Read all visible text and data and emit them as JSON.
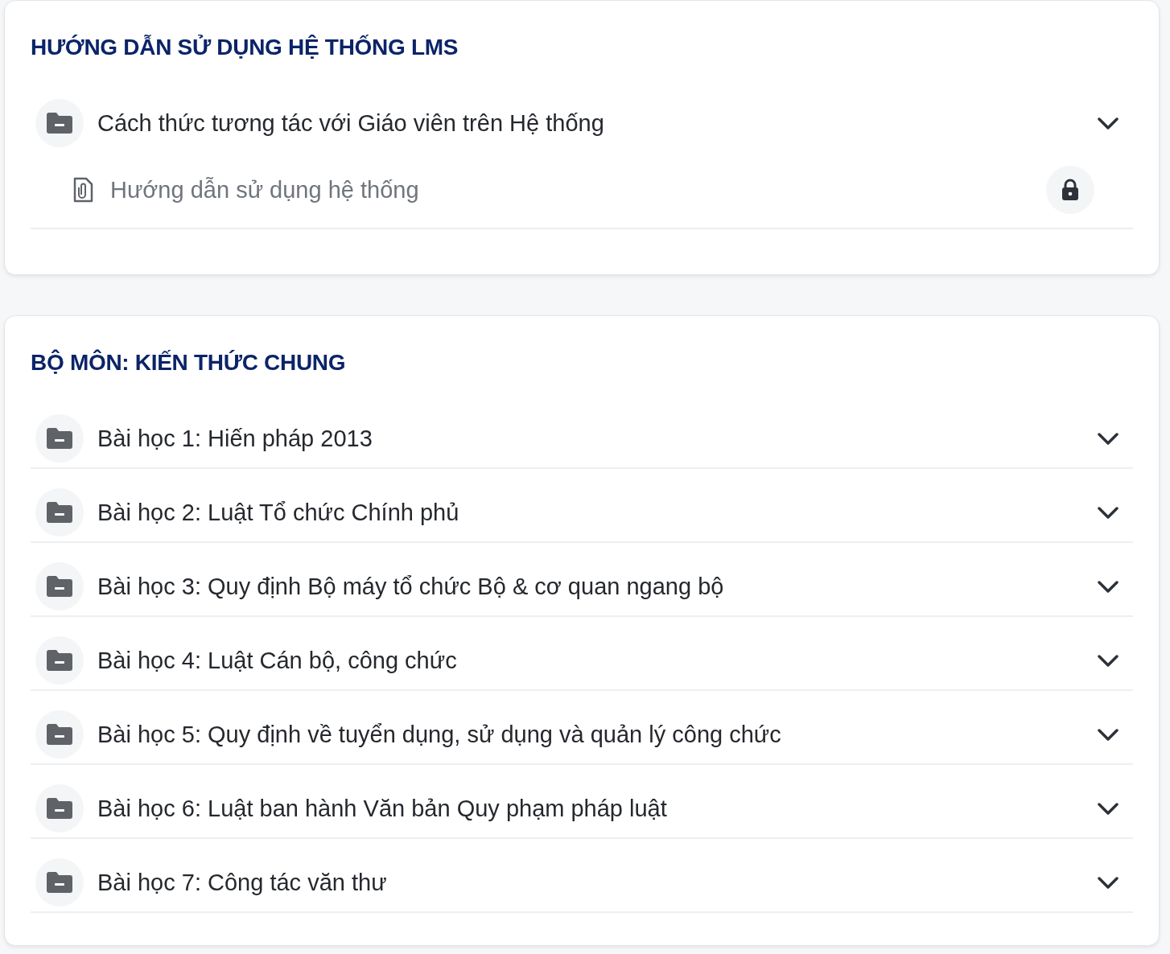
{
  "sections": [
    {
      "title": "HƯỚNG DẪN SỬ DỤNG HỆ THỐNG LMS",
      "topics": [
        {
          "title": "Cách thức tương tác với Giáo viên trên Hệ thống",
          "items": [
            {
              "title": "Hướng dẫn sử dụng hệ thống",
              "locked": true
            }
          ]
        }
      ]
    },
    {
      "title": "BỘ MÔN: KIẾN THỨC CHUNG",
      "topics": [
        {
          "title": "Bài học 1: Hiến pháp 2013"
        },
        {
          "title": "Bài học 2: Luật Tổ chức Chính phủ"
        },
        {
          "title": "Bài học 3: Quy định Bộ máy tổ chức Bộ & cơ quan ngang bộ"
        },
        {
          "title": "Bài học 4: Luật Cán bộ, công chức"
        },
        {
          "title": "Bài học 5: Quy định về tuyển dụng, sử dụng và quản lý công chức"
        },
        {
          "title": "Bài học 6: Luật ban hành Văn bản Quy phạm pháp luật"
        },
        {
          "title": "Bài học 7: Công tác văn thư"
        }
      ]
    }
  ]
}
